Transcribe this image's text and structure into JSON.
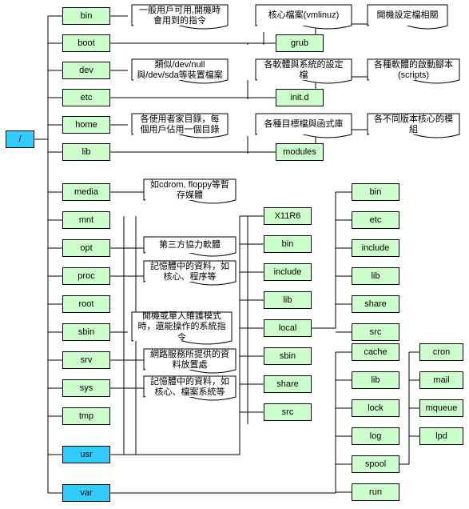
{
  "root": {
    "label": "/"
  },
  "dirs": {
    "bin": {
      "label": "bin"
    },
    "boot": {
      "label": "boot"
    },
    "dev": {
      "label": "dev"
    },
    "etc": {
      "label": "etc"
    },
    "home": {
      "label": "home"
    },
    "lib": {
      "label": "lib"
    },
    "media": {
      "label": "media"
    },
    "mnt": {
      "label": "mnt"
    },
    "opt": {
      "label": "opt"
    },
    "proc": {
      "label": "proc"
    },
    "root": {
      "label": "root"
    },
    "sbin": {
      "label": "sbin"
    },
    "srv": {
      "label": "srv"
    },
    "sys": {
      "label": "sys"
    },
    "tmp": {
      "label": "tmp"
    },
    "usr": {
      "label": "usr"
    },
    "var": {
      "label": "var"
    }
  },
  "boot_child": {
    "grub": {
      "label": "grub"
    }
  },
  "etc_child": {
    "initd": {
      "label": "init.d"
    }
  },
  "lib_child": {
    "modules": {
      "label": "modules"
    }
  },
  "usr_child": {
    "x11r6": {
      "label": "X11R6"
    },
    "bin": {
      "label": "bin"
    },
    "include": {
      "label": "include"
    },
    "lib": {
      "label": "lib"
    },
    "local": {
      "label": "local"
    },
    "sbin": {
      "label": "sbin"
    },
    "share": {
      "label": "share"
    },
    "src": {
      "label": "src"
    }
  },
  "local_child": {
    "bin": {
      "label": "bin"
    },
    "etc": {
      "label": "etc"
    },
    "include": {
      "label": "include"
    },
    "lib": {
      "label": "lib"
    },
    "share": {
      "label": "share"
    },
    "src": {
      "label": "src"
    }
  },
  "var_child": {
    "cache": {
      "label": "cache"
    },
    "lib": {
      "label": "lib"
    },
    "lock": {
      "label": "lock"
    },
    "log": {
      "label": "log"
    },
    "spool": {
      "label": "spool"
    },
    "run": {
      "label": "run"
    }
  },
  "spool_child": {
    "cron": {
      "label": "cron"
    },
    "mail": {
      "label": "mail"
    },
    "mqueue": {
      "label": "mqueue"
    },
    "lpd": {
      "label": "lpd"
    }
  },
  "notes": {
    "bin": "一般用戶可用,開機時會用到的指令",
    "boot": "核心檔案(vmlinuz)",
    "boot2": "開機設定檔相關",
    "dev": "類似/dev/null與/dev/sda等裝置檔案",
    "etc": "各軟體與系統的設定檔",
    "etc2": "各種軟體的啟動腳本(scripts)",
    "home": "各使用者家目錄，每個用戶佔用一個目錄",
    "lib": "各種目標檔與函式庫",
    "lib2": "各不同版本核心的模組",
    "media": "如cdrom, floppy等暫存媒體",
    "opt": "第三方協力軟體",
    "proc": "記憶體中的資料，如核心、程序等",
    "sbin": "開機或單人維護模式時，還能操作的系統指令",
    "srv": "網路服務所提供的資料放置處",
    "sys": "記憶體中的資料，如核心、檔案系統等"
  }
}
